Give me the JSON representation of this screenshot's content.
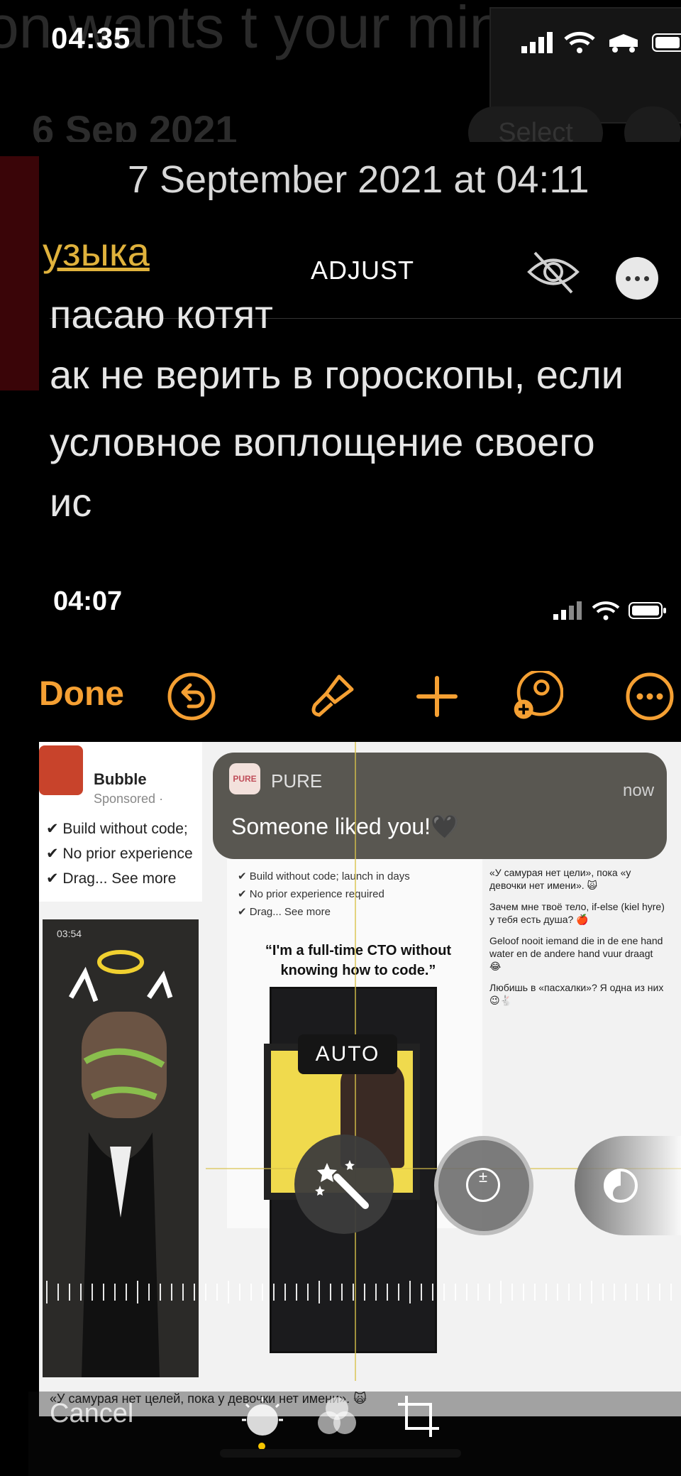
{
  "status_bar": {
    "time": "04:35"
  },
  "ghost": {
    "background_text": "on wants t your min",
    "date": "6 Sep 2021",
    "select_label": "Select"
  },
  "photo_header": {
    "date": "7 September 2021 at 04:11",
    "mode_title": "ADJUST"
  },
  "note": {
    "link": "узыка",
    "lines": [
      "пасаю котят",
      "ак не верить в гороскопы, если",
      "условное воплощение своего",
      "ис"
    ]
  },
  "inner_status": {
    "time": "04:07"
  },
  "editor_toolbar": {
    "done_label": "Done",
    "icons": [
      "undo-icon",
      "brush-icon",
      "plus-icon",
      "add-person-icon",
      "more-icon"
    ]
  },
  "ad": {
    "name": "Bubble",
    "sponsored": "Sponsored ·",
    "lines": [
      "✔ Build without code;",
      "✔ No prior experience",
      "✔ Drag... See more"
    ]
  },
  "left_photo": {
    "time": "03:54"
  },
  "caption": "«У самурая нет целей, пока у девочки нет имени». 🙀",
  "mid_panel": {
    "quote": "“I'm a full-time CTO without knowing how to code.”",
    "lines": [
      "✔ Build without code; launch in days",
      "✔ No prior experience required",
      "✔ Drag... See more"
    ]
  },
  "right_messages": [
    "«У самурая нет цели», пока «у девочки нет имени». 🙀",
    "Зачем мне твоё тело, if-else (kiel hyre) у тебя есть душа? 🍎",
    "Geloof nooit iemand die in de ene hand water en de andere hand vuur draagt 😂",
    "Любишь в «пасхалки»? Я одна из них 😉🐇"
  ],
  "notification": {
    "app": "PURE",
    "logo_text": "PURE",
    "time": "now",
    "message": "Someone liked you!🖤"
  },
  "adjust": {
    "auto_label": "AUTO",
    "selected_tool": "auto",
    "tools": [
      "magic-wand-icon",
      "exposure-icon",
      "brilliance-icon"
    ]
  },
  "bottom_bar": {
    "cancel_label": "Cancel",
    "tabs": [
      "adjust-dial-icon",
      "filters-icon",
      "crop-rotate-icon"
    ]
  },
  "colors": {
    "accent": "#f5a033",
    "guide": "#d8c24a",
    "link": "#e0b23c"
  }
}
